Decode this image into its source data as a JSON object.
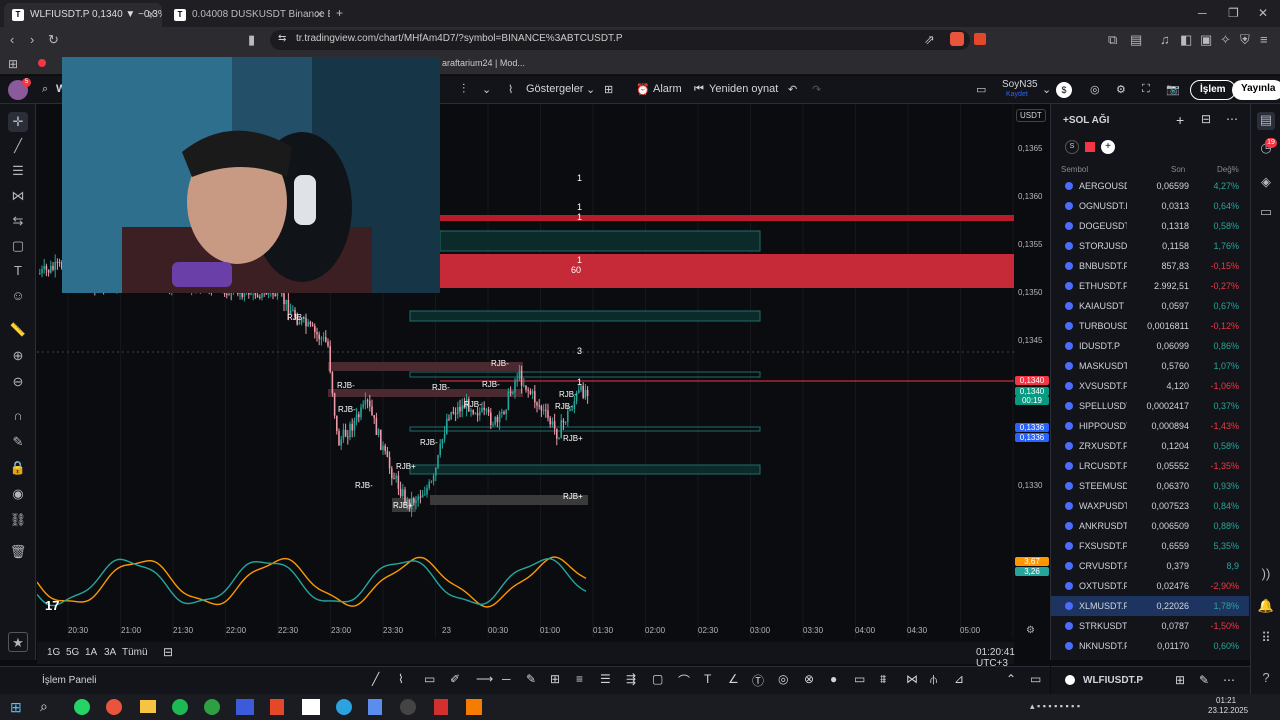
{
  "browser": {
    "tabs": [
      {
        "title": "WLFIUSDT.P 0,1340 ▼ −0,3% Sa",
        "active": true
      },
      {
        "title": "0.04008 DUSKUSDT Binance Bitcoin",
        "active": false
      }
    ],
    "new_tab": "+",
    "url": "tr.tradingview.com/chart/MHfAm4D7/?symbol=BINANCE%3ABTCUSDT.P",
    "bookmark": "araftarium24 | Mod..."
  },
  "toolbar": {
    "symbol_initial": "W",
    "indicators": "Göstergeler",
    "alert": "Alarm",
    "replay": "Yeniden oynat",
    "user": "SoyN35",
    "saved": "Kaydet",
    "trade": "İşlem",
    "publish": "Yayınla"
  },
  "chart": {
    "currency": "USDT",
    "price_labels": [
      "0,1365",
      "0,1360",
      "0,1355",
      "0,1350",
      "0,1345",
      "0,1330"
    ],
    "price_tags": [
      {
        "text": "0,1340",
        "color": "#f23645"
      },
      {
        "text": "0,1340",
        "color": "#089981"
      },
      {
        "text": "00:19",
        "color": "#089981"
      },
      {
        "text": "0,1336",
        "color": "#2962ff"
      },
      {
        "text": "0,1336",
        "color": "#2962ff"
      },
      {
        "text": "3,67",
        "color": "#ff9800"
      },
      {
        "text": "3,26",
        "color": "#26a69a"
      }
    ],
    "time_labels": [
      "20:30",
      "21:00",
      "21:30",
      "22:00",
      "22:30",
      "23:00",
      "23:30",
      "23",
      "00:30",
      "01:00",
      "01:30",
      "02:00",
      "02:30",
      "03:00",
      "03:30",
      "04:00",
      "04:30",
      "05:00"
    ],
    "markers": [
      "1",
      "1",
      "1",
      "1",
      "60",
      "3",
      "1"
    ],
    "zone_labels": [
      "RJB-",
      "RJB-",
      "RJB-",
      "RJB-",
      "RJB-",
      "RJB-",
      "RJB-",
      "RJB-",
      "RJB-",
      "RJB+",
      "RJB-",
      "RJB+",
      "RJB-",
      "RJB+",
      "RJB+"
    ],
    "pane_buttons": [
      "O",
      "L"
    ],
    "logo": "17",
    "clock": "01:20:41 UTC+3"
  },
  "intervals": [
    "1G",
    "5G",
    "1A",
    "3A",
    "Tümü"
  ],
  "bottom_panel": "İşlem Paneli",
  "watchlist": {
    "title": "+SOL AĞI",
    "col_symbol": "Sembol",
    "col_last": "Son",
    "col_change": "Değ%",
    "rows": [
      {
        "sym": "AERGOUSD",
        "last": "0,06599",
        "chg": "4,27%",
        "up": true
      },
      {
        "sym": "OGNUSDT.F",
        "last": "0,0313",
        "chg": "0,64%",
        "up": true
      },
      {
        "sym": "DOGEUSDT",
        "last": "0,1318",
        "chg": "0,58%",
        "up": true
      },
      {
        "sym": "STORJUSDT",
        "last": "0,1158",
        "chg": "1,76%",
        "up": true
      },
      {
        "sym": "BNBUSDT.P",
        "last": "857,83",
        "chg": "-0,15%",
        "up": false
      },
      {
        "sym": "ETHUSDT.P",
        "last": "2.992,51",
        "chg": "-0,27%",
        "up": false
      },
      {
        "sym": "KAIAUSDT",
        "last": "0,0597",
        "chg": "0,67%",
        "up": true
      },
      {
        "sym": "TURBOUSD",
        "last": "0,0016811",
        "chg": "-0,12%",
        "up": false
      },
      {
        "sym": "IDUSDT.P",
        "last": "0,06099",
        "chg": "0,86%",
        "up": true
      },
      {
        "sym": "MASKUSDT.",
        "last": "0,5760",
        "chg": "1,07%",
        "up": true
      },
      {
        "sym": "XVSUSDT.P",
        "last": "4,120",
        "chg": "-1,06%",
        "up": false
      },
      {
        "sym": "SPELLUSDT",
        "last": "0,0002417",
        "chg": "0,37%",
        "up": true
      },
      {
        "sym": "HIPPOUSDT",
        "last": "0,000894",
        "chg": "-1,43%",
        "up": false
      },
      {
        "sym": "ZRXUSDT.P",
        "last": "0,1204",
        "chg": "0,58%",
        "up": true
      },
      {
        "sym": "LRCUSDT.P",
        "last": "0,05552",
        "chg": "-1,35%",
        "up": false
      },
      {
        "sym": "STEEMUSDT",
        "last": "0,06370",
        "chg": "0,93%",
        "up": true
      },
      {
        "sym": "WAXPUSDT.",
        "last": "0,007523",
        "chg": "0,84%",
        "up": true
      },
      {
        "sym": "ANKRUSDT.",
        "last": "0,006509",
        "chg": "0,88%",
        "up": true
      },
      {
        "sym": "FXSUSDT.P",
        "last": "0,6559",
        "chg": "5,35%",
        "up": true
      },
      {
        "sym": "CRVUSDT.P",
        "last": "0,379",
        "chg": "8,9",
        "up": true
      },
      {
        "sym": "OXTUSDT.F",
        "last": "0,02476",
        "chg": "-2,90%",
        "up": false
      },
      {
        "sym": "XLMUSDT.P",
        "last": "0,22026",
        "chg": "1,78%",
        "up": true
      },
      {
        "sym": "STRKUSDT",
        "last": "0,0787",
        "chg": "-1,50%",
        "up": false
      },
      {
        "sym": "NKNUSDT.F",
        "last": "0,01170",
        "chg": "0,60%",
        "up": true
      }
    ],
    "footer_symbol": "WLFIUSDT.P"
  },
  "notifications_count": "19",
  "taskbar": {
    "time": "01:21",
    "date": "23.12.2025"
  },
  "colors": {
    "up": "#26a69a",
    "down": "#f23645",
    "accent": "#2962ff"
  }
}
